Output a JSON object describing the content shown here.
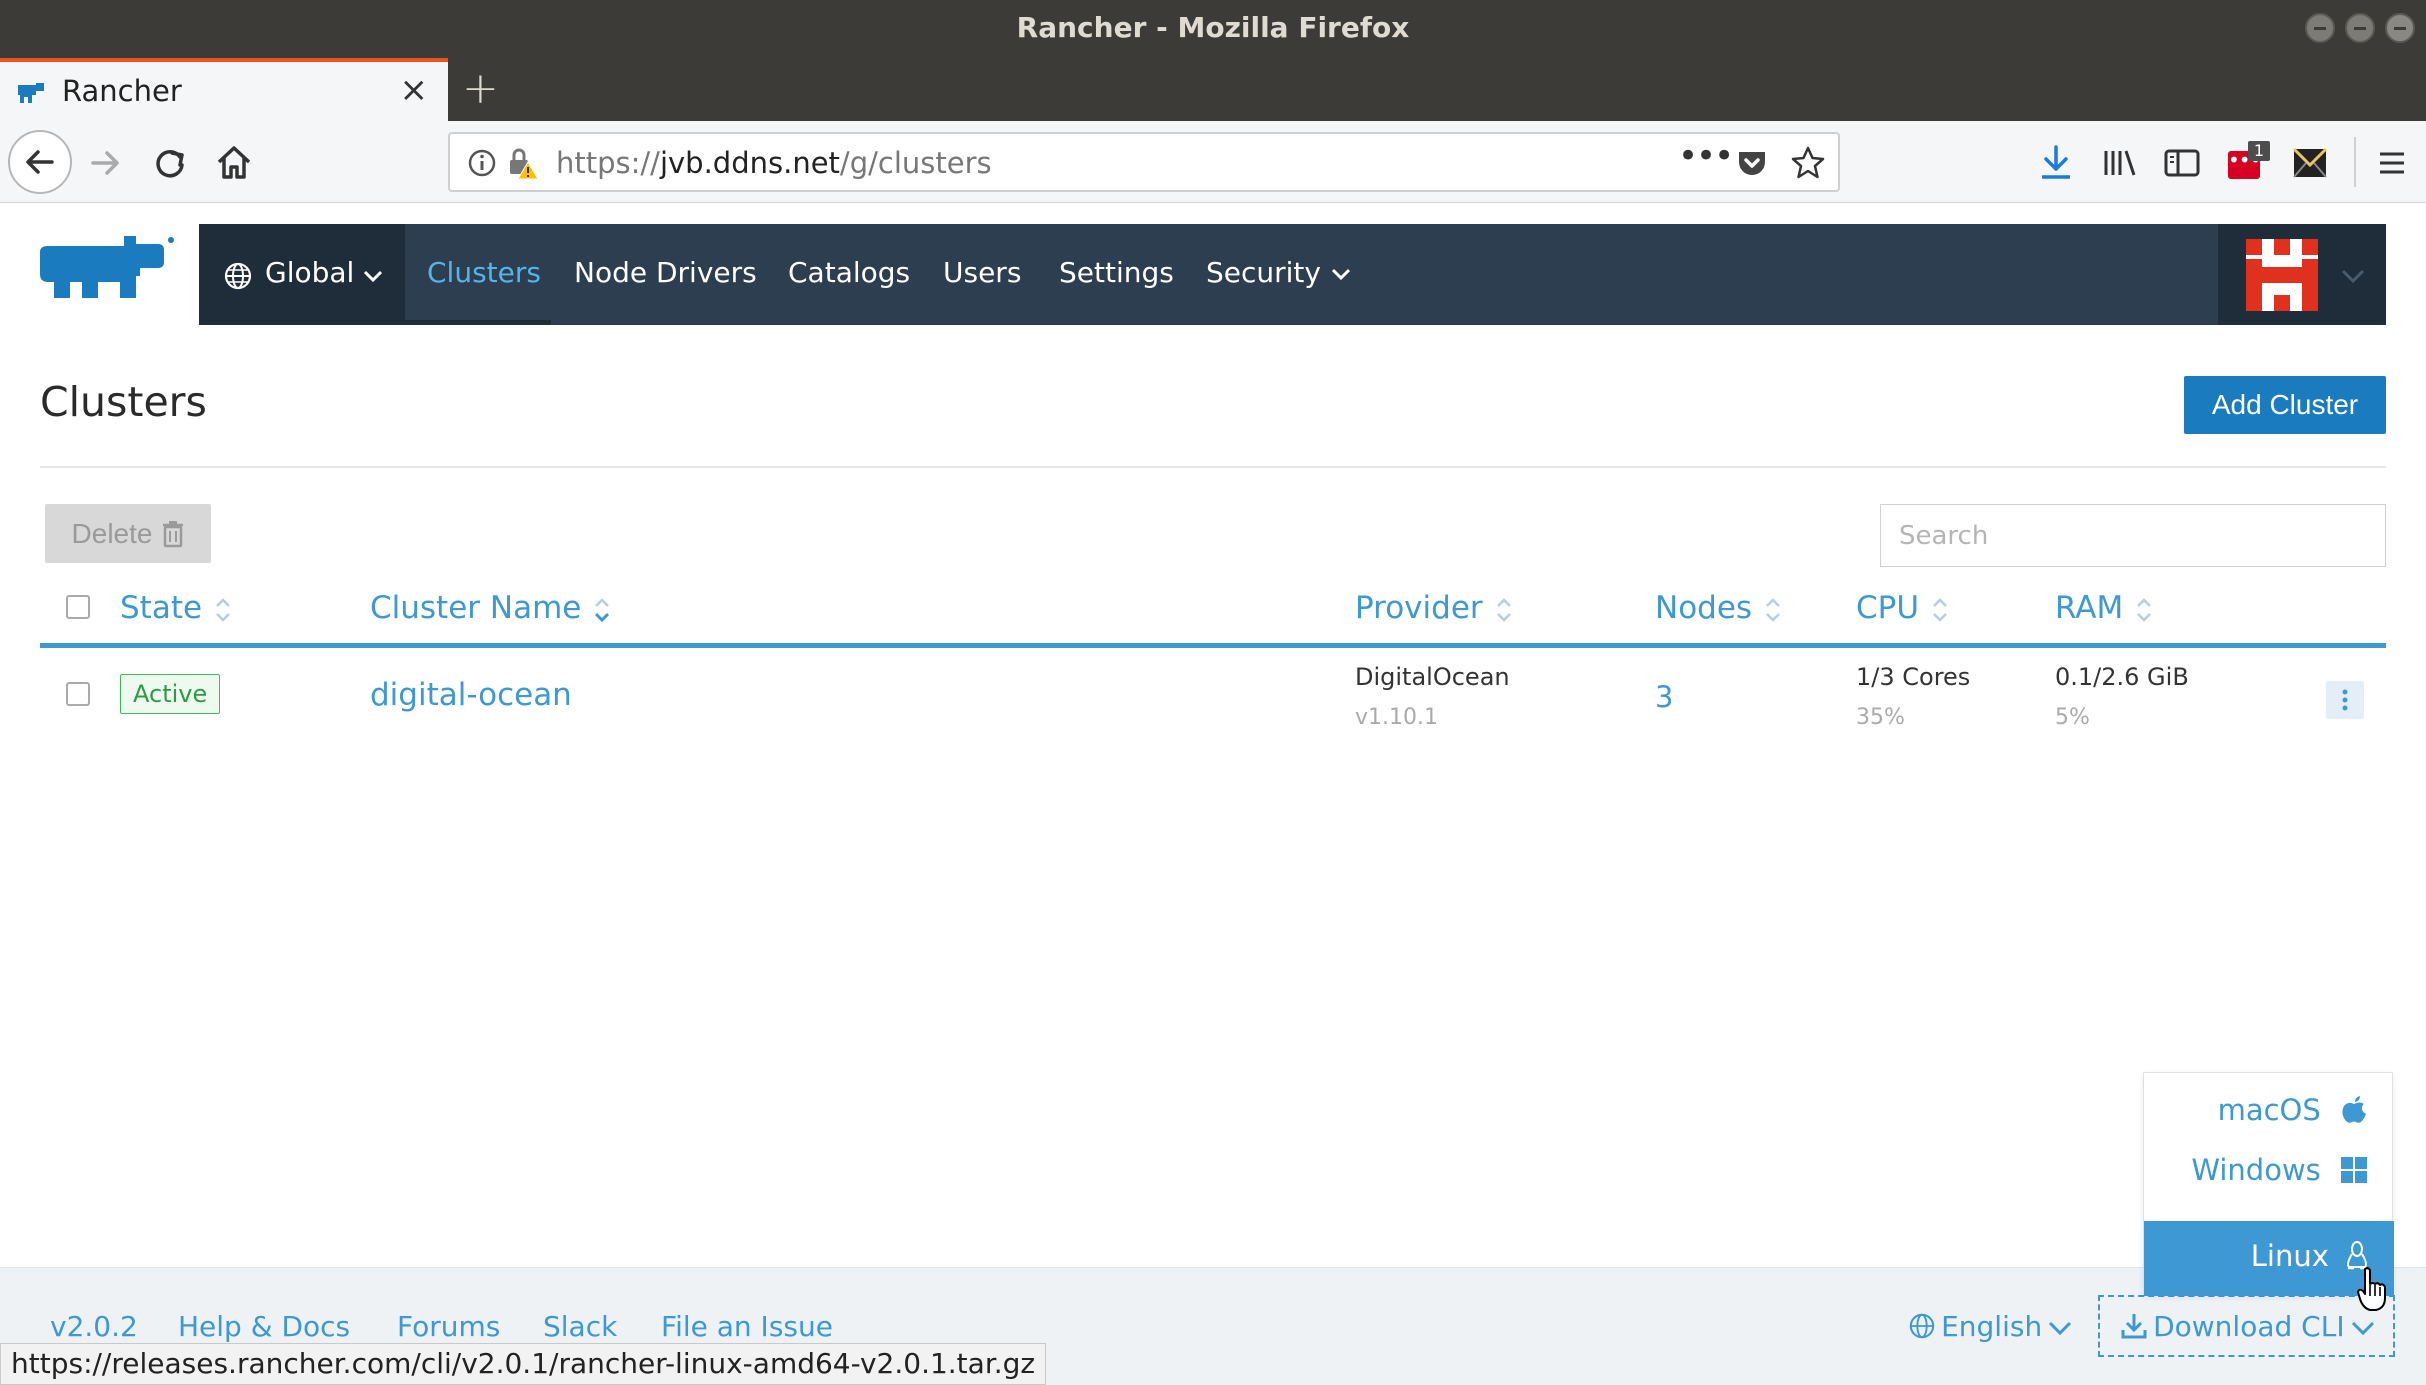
{
  "window": {
    "title": "Rancher - Mozilla Firefox"
  },
  "browser": {
    "tab_title": "Rancher",
    "url_protocol": "https://",
    "url_host": "jvb.ddns.net",
    "url_path": "/g/clusters",
    "extension_badge": "1"
  },
  "header": {
    "global_label": "Global",
    "nav": [
      "Clusters",
      "Node Drivers",
      "Catalogs",
      "Users",
      "Settings",
      "Security"
    ]
  },
  "page": {
    "title": "Clusters",
    "add_button": "Add Cluster",
    "delete_button": "Delete",
    "search_placeholder": "Search"
  },
  "table": {
    "columns": [
      "State",
      "Cluster Name",
      "Provider",
      "Nodes",
      "CPU",
      "RAM"
    ],
    "rows": [
      {
        "state": "Active",
        "name": "digital-ocean",
        "provider": "DigitalOcean",
        "provider_version": "v1.10.1",
        "nodes": "3",
        "cpu": "1/3 Cores",
        "cpu_pct": "35%",
        "ram": "0.1/2.6 GiB",
        "ram_pct": "5%"
      }
    ]
  },
  "download_menu": {
    "items": [
      "macOS",
      "Windows",
      "Linux"
    ],
    "selected": "Linux"
  },
  "footer": {
    "version": "v2.0.2",
    "help": "Help & Docs",
    "forums": "Forums",
    "slack": "Slack",
    "issue": "File an Issue",
    "language": "English",
    "download_cli": "Download CLI"
  },
  "status_url": "https://releases.rancher.com/cli/v2.0.1/rancher-linux-amd64-v2.0.1.tar.gz",
  "colors": {
    "accent": "#3d98d3",
    "nav_bg": "#2c3e50",
    "nav_dark": "#1f2d3a",
    "active_green": "#41b85d",
    "primary_button": "#1a7bbf"
  }
}
